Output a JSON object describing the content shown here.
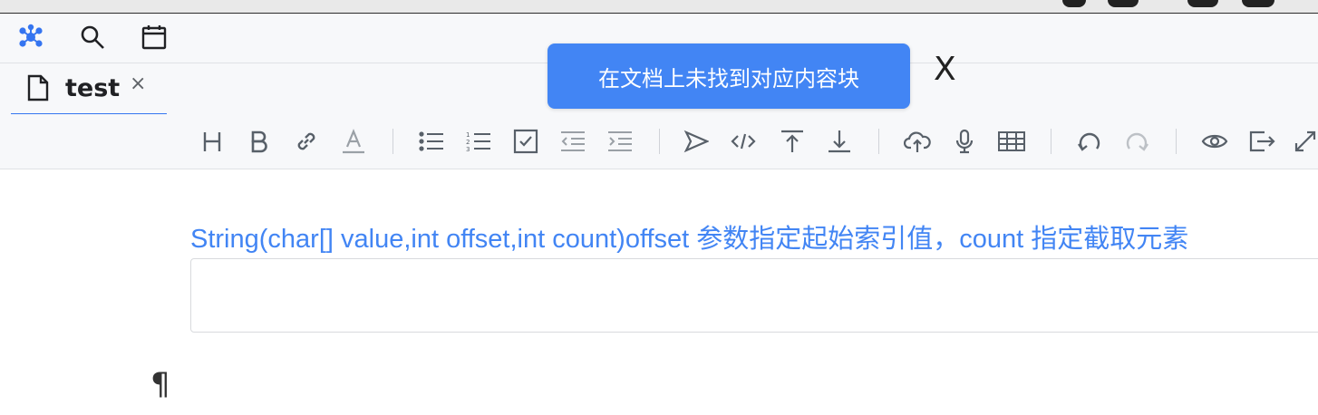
{
  "app": {
    "toast_message": "在文档上未找到对应内容块",
    "toast_close": "X"
  },
  "tabs": [
    {
      "label": "test",
      "close": "×"
    }
  ],
  "content": {
    "text": "String(char[] value,int offset,int count)offset 参数指定起始索引值，count 指定截取元素",
    "input_value": "",
    "paragraph_mark": "¶"
  },
  "top_icons": [
    "graph-icon",
    "search-icon",
    "calendar-icon"
  ],
  "toolbar_icons": [
    "heading-icon",
    "bold-icon",
    "link-icon",
    "text-color-icon",
    "bullet-list-icon",
    "ordered-list-icon",
    "checklist-icon",
    "outdent-icon",
    "indent-icon",
    "send-icon",
    "code-icon",
    "upload-top-icon",
    "download-bottom-icon",
    "cloud-upload-icon",
    "microphone-icon",
    "table-icon",
    "undo-icon",
    "redo-icon",
    "preview-icon",
    "export-icon",
    "fullscreen-icon"
  ],
  "colors": {
    "accent": "#3575f0",
    "toast_bg": "#4285f4",
    "content_text": "#4285f4",
    "icon": "#586069"
  }
}
